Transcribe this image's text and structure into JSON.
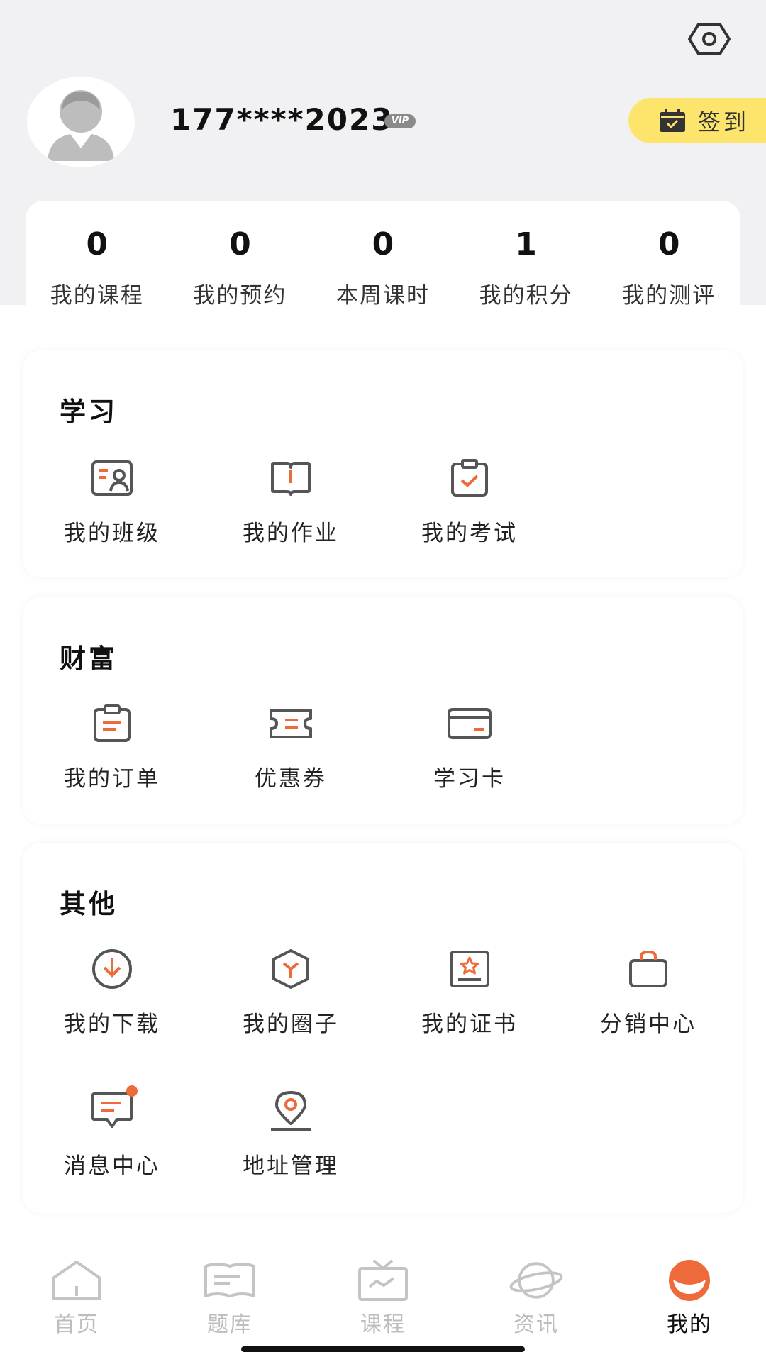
{
  "profile": {
    "username": "177****2023",
    "vip_label": "VIP",
    "checkin_label": "签到"
  },
  "stats": [
    {
      "value": "0",
      "label": "我的课程"
    },
    {
      "value": "0",
      "label": "我的预约"
    },
    {
      "value": "0",
      "label": "本周课时"
    },
    {
      "value": "1",
      "label": "我的积分"
    },
    {
      "value": "0",
      "label": "我的测评"
    }
  ],
  "sections": {
    "study": {
      "title": "学习",
      "items": [
        {
          "label": "我的班级",
          "icon": "class-icon"
        },
        {
          "label": "我的作业",
          "icon": "homework-icon"
        },
        {
          "label": "我的考试",
          "icon": "exam-icon"
        }
      ]
    },
    "wealth": {
      "title": "财富",
      "items": [
        {
          "label": "我的订单",
          "icon": "order-icon"
        },
        {
          "label": "优惠券",
          "icon": "coupon-icon"
        },
        {
          "label": "学习卡",
          "icon": "study-card-icon"
        }
      ]
    },
    "other": {
      "title": "其他",
      "items": [
        {
          "label": "我的下载",
          "icon": "download-icon"
        },
        {
          "label": "我的圈子",
          "icon": "circle-icon"
        },
        {
          "label": "我的证书",
          "icon": "certificate-icon"
        },
        {
          "label": "分销中心",
          "icon": "distribution-icon"
        },
        {
          "label": "消息中心",
          "icon": "message-icon"
        },
        {
          "label": "地址管理",
          "icon": "location-icon"
        }
      ]
    }
  },
  "tabs": [
    {
      "label": "首页",
      "icon": "home-icon"
    },
    {
      "label": "题库",
      "icon": "question-bank-icon"
    },
    {
      "label": "课程",
      "icon": "course-tv-icon"
    },
    {
      "label": "资讯",
      "icon": "planet-icon"
    },
    {
      "label": "我的",
      "icon": "me-icon"
    }
  ],
  "colors": {
    "accent": "#ee6a3a",
    "icon_gray": "#555555",
    "checkin_bg": "#fde56d",
    "tab_inactive": "#bdbdbd"
  }
}
